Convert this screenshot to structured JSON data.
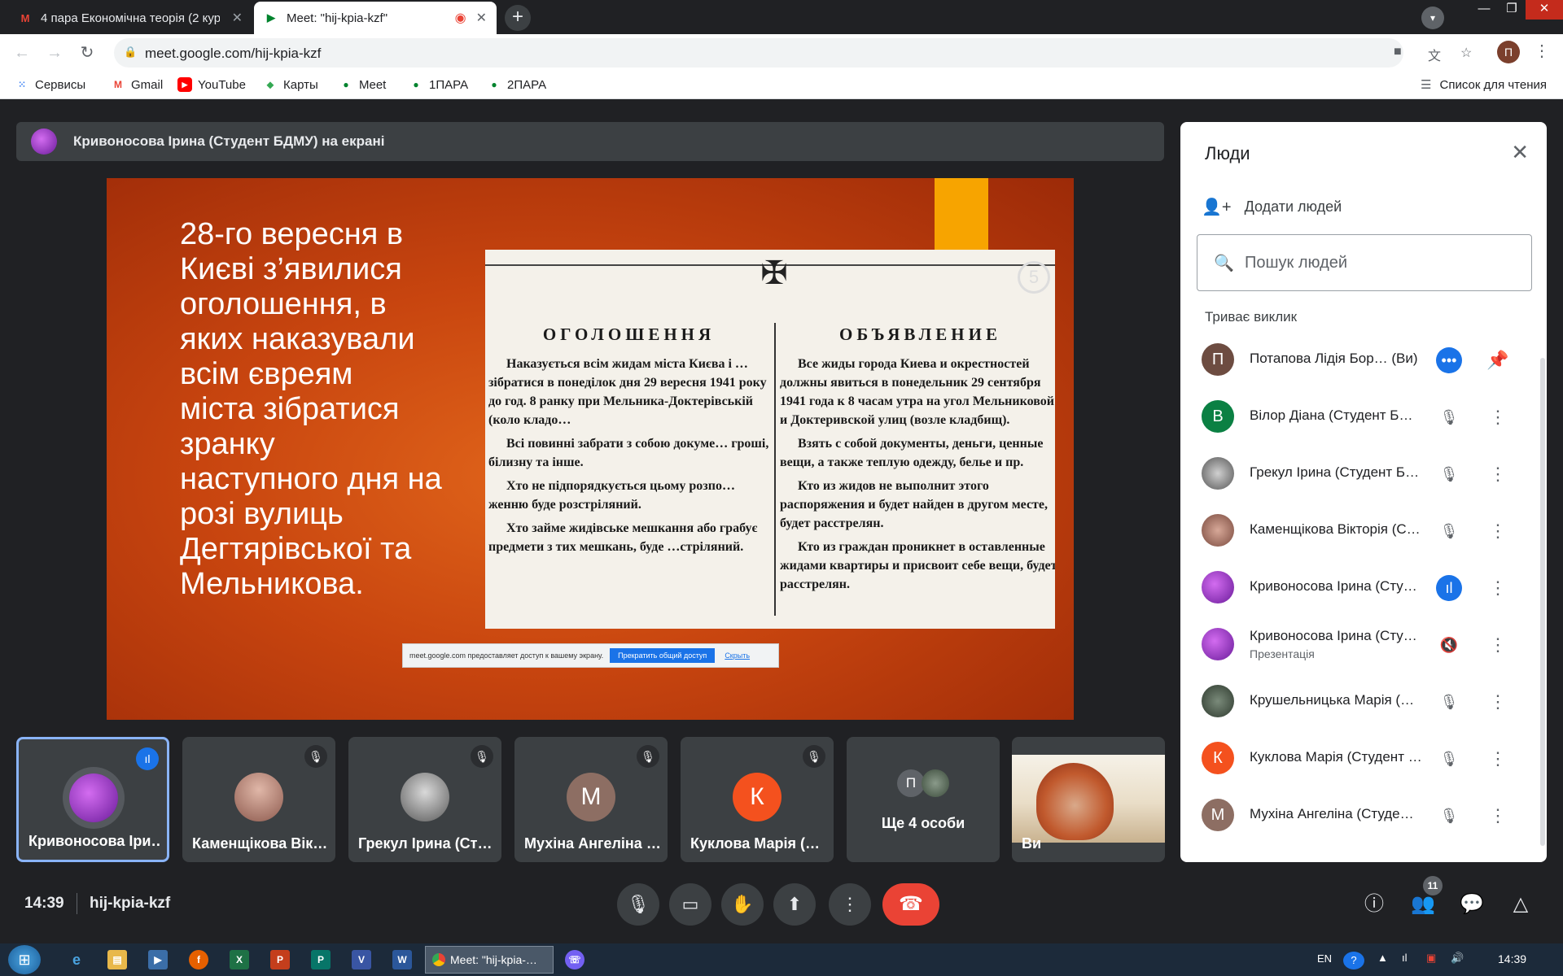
{
  "browser": {
    "tabs": [
      {
        "label": "4 пара Економічна теорія (2 кур",
        "favicon": "gmail-icon"
      },
      {
        "label": "Meet: \"hij-kpia-kzf\"",
        "favicon": "meet-icon"
      }
    ],
    "url": "meet.google.com/hij-kpia-kzf",
    "profile_initial": "П",
    "bookmarks": [
      "Сервисы",
      "Gmail",
      "YouTube",
      "Карты",
      "Meet",
      "1ПАРА",
      "2ПАРА"
    ],
    "reading_list": "Список для чтения"
  },
  "meet": {
    "presenter_banner": "Кривоносова Ірина (Студент БДМУ) на екрані",
    "slide": {
      "heading_lines": [
        "28-го вересня в",
        "Києві з’явилися",
        "оголошення, в",
        "яких наказували",
        "всім євреям",
        "міста зібратися",
        "зранку",
        "наступного дня на",
        "розі вулиць",
        "Дегтярівської та",
        "Мельникова."
      ],
      "doc_left_title": "ОГОЛОШЕННЯ",
      "doc_left_paragraphs": [
        "Наказується всім жидам міста Києва і … зібратися в понеділок дня 29 вересня 1941 року до год. 8 ранку при Мельника-Доктерівській (коло кладо…",
        "Всі повинні забрати з собою докуме… гроші, білизну та інше.",
        "Хто не підпорядкується цьому розпо… женню буде розстріляний.",
        "Хто займе жидівське мешкання або грабує предмети з тих мешкань, буде …стріляний."
      ],
      "doc_right_title": "ОБЪЯВЛЕНИЕ",
      "doc_right_paragraphs": [
        "Все жиды города Киева и окрестностей должны явиться в понедельник 29 сентября 1941 года к 8 часам утра на угол Мельниковой и Доктеривской улиц (возле кладбищ).",
        "Взять с собой документы, деньги, ценные вещи, а также теплую одежду, белье и пр.",
        "Кто из жидов не выполнит этого распоряжения и будет найден в другом месте, будет расстрелян.",
        "Кто из граждан проникнет в оставленные жидами квартиры и присвоит себе вещи, будет расстрелян."
      ],
      "doc_badge": "5",
      "share_notice": "meet.google.com предоставляет доступ к вашему экрану.",
      "share_stop": "Прекратить общий доступ",
      "share_hide": "Скрыть"
    },
    "tiles": [
      {
        "name": "Кривоносова Іри…",
        "initial": "",
        "color": "#7b2fa6",
        "speaking": true
      },
      {
        "name": "Каменщікова Вік…",
        "initial": "",
        "color": "#b07a6a",
        "speaking": false
      },
      {
        "name": "Грекул Ірина (Ст…",
        "initial": "",
        "color": "#8a8a8a",
        "speaking": false
      },
      {
        "name": "Мухіна Ангеліна …",
        "initial": "М",
        "color": "#8d6e63",
        "speaking": false
      },
      {
        "name": "Куклова Марія (…",
        "initial": "К",
        "color": "#f4511e",
        "speaking": false
      }
    ],
    "more_tile": {
      "label": "Ще 4 особи",
      "initial": "П"
    },
    "self_tile_label": "Ви",
    "time": "14:39",
    "meeting_code": "hij-kpia-kzf",
    "people_count": "11"
  },
  "panel": {
    "title": "Люди",
    "add_people": "Додати людей",
    "search_placeholder": "Пошук людей",
    "section": "Триває виклик",
    "participants": [
      {
        "name": "Потапова Лідія Бор…",
        "suffix": "(Ви)",
        "initial": "П",
        "color": "#6d4c41",
        "mic": "more-options-active",
        "sub": ""
      },
      {
        "name": "Вілор Діана (Студент Б…",
        "initial": "В",
        "color": "#0b8043",
        "mic": "muted",
        "sub": ""
      },
      {
        "name": "Грекул Ірина (Студент Б…",
        "initial": "",
        "color": "#757575",
        "mic": "muted",
        "sub": ""
      },
      {
        "name": "Каменщікова Вікторія (С…",
        "initial": "",
        "color": "#a1887f",
        "mic": "muted",
        "sub": ""
      },
      {
        "name": "Кривоносова Ірина (Сту…",
        "initial": "",
        "color": "#7b2fa6",
        "mic": "speaking",
        "sub": ""
      },
      {
        "name": "Кривоносова Ірина (Сту…",
        "initial": "",
        "color": "#7b2fa6",
        "mic": "volume-off",
        "sub": "Презентація"
      },
      {
        "name": "Крушельницька Марія (…",
        "initial": "",
        "color": "#455a64",
        "mic": "muted",
        "sub": ""
      },
      {
        "name": "Куклова Марія (Студент …",
        "initial": "К",
        "color": "#f4511e",
        "mic": "muted",
        "sub": ""
      },
      {
        "name": "Мухіна Ангеліна (Студе…",
        "initial": "М",
        "color": "#8d6e63",
        "mic": "muted",
        "sub": ""
      }
    ]
  },
  "taskbar": {
    "chrome_item": "Meet: \"hij-kpia-…",
    "lang": "EN",
    "clock": "14:39"
  }
}
